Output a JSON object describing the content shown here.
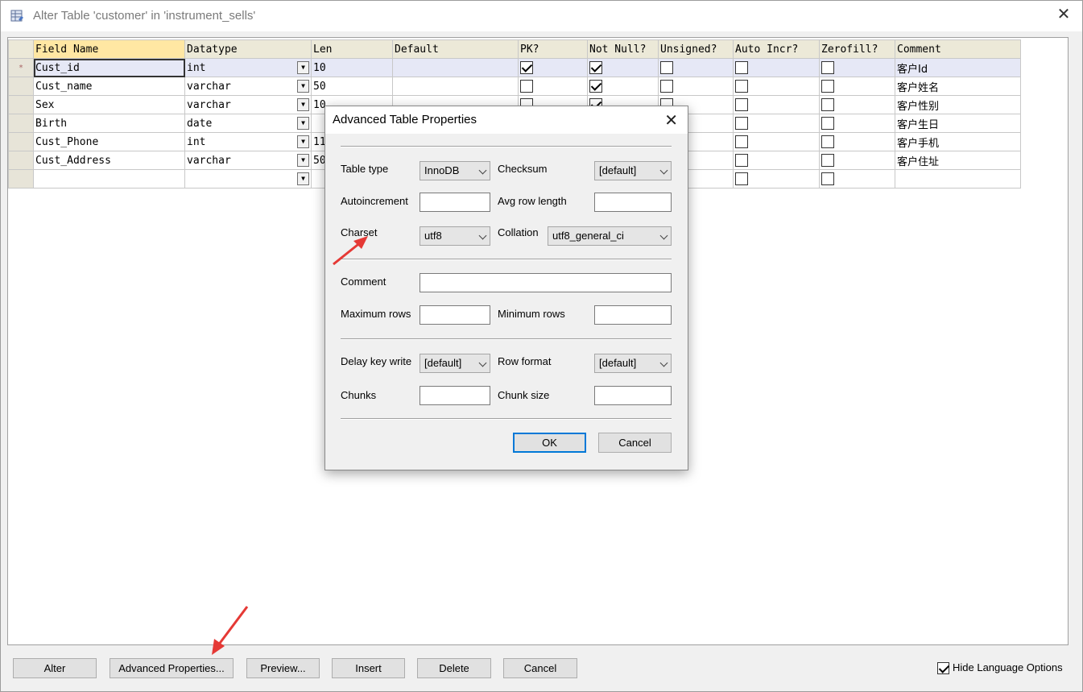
{
  "window": {
    "title": "Alter Table 'customer' in 'instrument_sells'"
  },
  "grid": {
    "columns": [
      "Field Name",
      "Datatype",
      "Len",
      "Default",
      "PK?",
      "Not Null?",
      "Unsigned?",
      "Auto Incr?",
      "Zerofill?",
      "Comment"
    ],
    "current_row_marker": "*",
    "rows": [
      {
        "field": "Cust_id",
        "type": "int",
        "len": "10",
        "default": "",
        "pk": true,
        "notnull": true,
        "unsigned": false,
        "autoinc": false,
        "zerofill": false,
        "comment": "客户Id"
      },
      {
        "field": "Cust_name",
        "type": "varchar",
        "len": "50",
        "default": "",
        "pk": false,
        "notnull": true,
        "unsigned": false,
        "autoinc": false,
        "zerofill": false,
        "comment": "客户姓名"
      },
      {
        "field": "Sex",
        "type": "varchar",
        "len": "10",
        "default": "",
        "pk": false,
        "notnull": true,
        "unsigned": false,
        "autoinc": false,
        "zerofill": false,
        "comment": "客户性别"
      },
      {
        "field": "Birth",
        "type": "date",
        "len": "",
        "default": "",
        "pk": false,
        "notnull": false,
        "unsigned": false,
        "autoinc": false,
        "zerofill": false,
        "comment": "客户生日"
      },
      {
        "field": "Cust_Phone",
        "type": "int",
        "len": "11",
        "default": "",
        "pk": false,
        "notnull": false,
        "unsigned": false,
        "autoinc": false,
        "zerofill": false,
        "comment": "客户手机"
      },
      {
        "field": "Cust_Address",
        "type": "varchar",
        "len": "50",
        "default": "",
        "pk": false,
        "notnull": false,
        "unsigned": false,
        "autoinc": false,
        "zerofill": false,
        "comment": "客户住址"
      },
      {
        "field": "",
        "type": "",
        "len": "",
        "default": "",
        "pk": false,
        "notnull": false,
        "unsigned": false,
        "autoinc": false,
        "zerofill": false,
        "comment": ""
      }
    ]
  },
  "buttons": {
    "alter": "Alter",
    "advanced": "Advanced Properties...",
    "preview": "Preview...",
    "insert": "Insert",
    "delete": "Delete",
    "cancel": "Cancel"
  },
  "hide_language": {
    "label": "Hide Language Options",
    "checked": true
  },
  "dialog": {
    "title": "Advanced Table Properties",
    "table_type": {
      "label": "Table type",
      "value": "InnoDB"
    },
    "checksum": {
      "label": "Checksum",
      "value": "[default]"
    },
    "autoincrement": {
      "label": "Autoincrement",
      "value": ""
    },
    "avg_row_length": {
      "label": "Avg row length",
      "value": ""
    },
    "charset": {
      "label": "Charset",
      "value": "utf8"
    },
    "collation": {
      "label": "Collation",
      "value": "utf8_general_ci"
    },
    "comment": {
      "label": "Comment",
      "value": ""
    },
    "max_rows": {
      "label": "Maximum rows",
      "value": ""
    },
    "min_rows": {
      "label": "Minimum rows",
      "value": ""
    },
    "delay_key_write": {
      "label": "Delay key write",
      "value": "[default]"
    },
    "row_format": {
      "label": "Row format",
      "value": "[default]"
    },
    "chunks": {
      "label": "Chunks",
      "value": ""
    },
    "chunk_size": {
      "label": "Chunk size",
      "value": ""
    },
    "ok": "OK",
    "cancel": "Cancel"
  },
  "annotation_color": "#e53935"
}
